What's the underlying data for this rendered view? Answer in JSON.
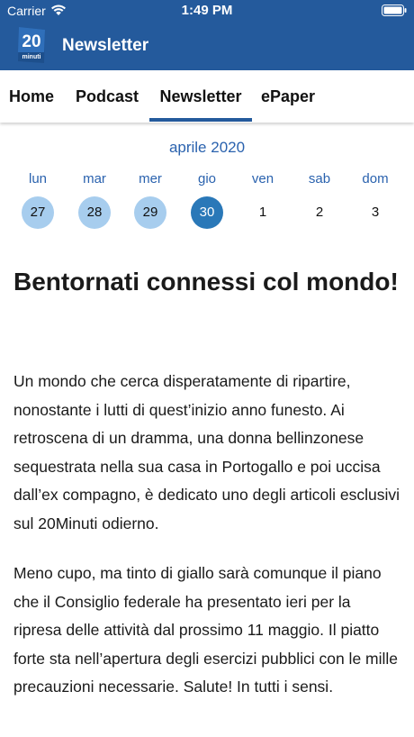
{
  "status_bar": {
    "carrier": "Carrier",
    "time": "1:49 PM"
  },
  "header": {
    "title": "Newsletter",
    "logo_text": "20",
    "logo_subtext": "minuti",
    "color": "#245a9c"
  },
  "tabs": [
    {
      "label": "Home",
      "active": false
    },
    {
      "label": "Podcast",
      "active": false
    },
    {
      "label": "Newsletter",
      "active": true
    },
    {
      "label": "ePaper",
      "active": false
    }
  ],
  "calendar": {
    "month": "aprile 2020",
    "weekdays": [
      "lun",
      "mar",
      "mer",
      "gio",
      "ven",
      "sab",
      "dom"
    ],
    "days": [
      {
        "label": "27",
        "state": "past"
      },
      {
        "label": "28",
        "state": "past"
      },
      {
        "label": "29",
        "state": "past"
      },
      {
        "label": "30",
        "state": "selected"
      },
      {
        "label": "1",
        "state": "future"
      },
      {
        "label": "2",
        "state": "future"
      },
      {
        "label": "3",
        "state": "future"
      }
    ]
  },
  "article": {
    "title": "Bentornati connessi col mondo!",
    "paragraphs": [
      "Un mondo che cerca disperatamente di ripartire, nonostante i lutti di quest’inizio anno funesto. Ai retroscena di un dramma, una donna bellinzonese sequestrata nella sua casa in Portogallo e poi uccisa dall’ex compagno, è dedicato uno degli articoli esclusivi sul 20Minuti odierno.",
      "Meno cupo, ma tinto di giallo sarà comunque il piano che il Consiglio federale ha presentato ieri per la ripresa delle attività dal prossimo 11 maggio. Il piatto forte sta nell’apertura degli esercizi pubblici con le mille precauzioni necessarie. Salute! In tutti i sensi."
    ]
  },
  "colors": {
    "accent": "#2a62ae",
    "selected_day": "#2a78b8",
    "past_day": "#a7cdee"
  }
}
